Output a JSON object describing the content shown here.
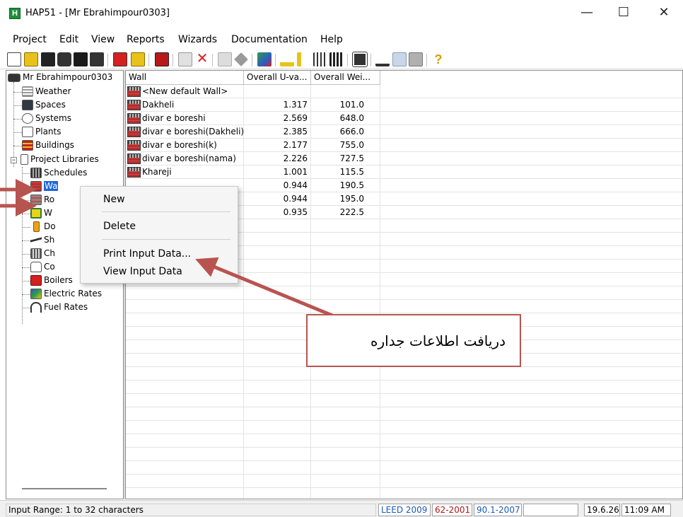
{
  "window": {
    "title": "HAP51 - [Mr Ebrahimpour0303]",
    "app_icon_letter": "H",
    "minimize_glyph": "—",
    "maximize_glyph": "☐",
    "close_glyph": "✕"
  },
  "menubar": {
    "items": [
      "Project",
      "Edit",
      "View",
      "Reports",
      "Wizards",
      "Documentation",
      "Help"
    ]
  },
  "toolbar": {
    "icons": [
      "new-icon",
      "open-icon",
      "save-icon",
      "library-icon",
      "print-icon",
      "print-preview-icon",
      "edit-icon",
      "folder-icon",
      "building-icon",
      "copy-icon",
      "delete-icon",
      "properties-icon",
      "diamond-icon",
      "color-icon",
      "wizard-icon",
      "arrows-icon",
      "grid-icon",
      "table-icon",
      "calculator-icon",
      "report-icon",
      "chart-icon",
      "graph-icon",
      "help-icon"
    ],
    "colors": {
      "red": "#d42020",
      "yellow": "#e8c21a",
      "dark": "#333333",
      "green": "#2e9d46",
      "blue": "#2c5cc7",
      "gray": "#9a9a9a"
    }
  },
  "tree": {
    "root": "Mr Ebrahimpour0303",
    "top_items": [
      "Weather",
      "Spaces",
      "Systems",
      "Plants",
      "Buildings"
    ],
    "libraries": {
      "label": "Project Libraries",
      "expander": "−",
      "children": [
        "Schedules",
        "Wa",
        "Ro",
        "W",
        "Do",
        "Sh",
        "Ch",
        "Co",
        "Boilers",
        "Electric Rates",
        "Fuel Rates"
      ]
    }
  },
  "list": {
    "columns": [
      "Wall",
      "Overall U-va...",
      "Overall Wei..."
    ],
    "rows": [
      {
        "name": "<New default Wall>",
        "u": "",
        "w": ""
      },
      {
        "name": "Dakheli",
        "u": "1.317",
        "w": "101.0"
      },
      {
        "name": "divar e boreshi",
        "u": "2.569",
        "w": "648.0"
      },
      {
        "name": "divar e boreshi(Dakheli)",
        "u": "2.385",
        "w": "666.0"
      },
      {
        "name": "divar e boreshi(k)",
        "u": "2.177",
        "w": "755.0"
      },
      {
        "name": "divar e boreshi(nama)",
        "u": "2.226",
        "w": "727.5"
      },
      {
        "name": "Khareji",
        "u": "1.001",
        "w": "115.5"
      },
      {
        "name": "",
        "u": "0.944",
        "w": "190.5"
      },
      {
        "name": "",
        "u": "0.944",
        "w": "195.0"
      },
      {
        "name": "",
        "u": "0.935",
        "w": "222.5"
      }
    ]
  },
  "context_menu": {
    "items": [
      "New",
      "Delete",
      "Print Input Data...",
      "View Input Data"
    ]
  },
  "annotation": {
    "text": "دریافت اطلاعات جداره",
    "color": "#b85450"
  },
  "statusbar": {
    "hint": "Input Range: 1 to 32 characters",
    "leed": "LEED 2009",
    "std62": "62-2001",
    "std90": "90.1-2007",
    "date": "19.6.26",
    "time": "11:09 AM"
  }
}
